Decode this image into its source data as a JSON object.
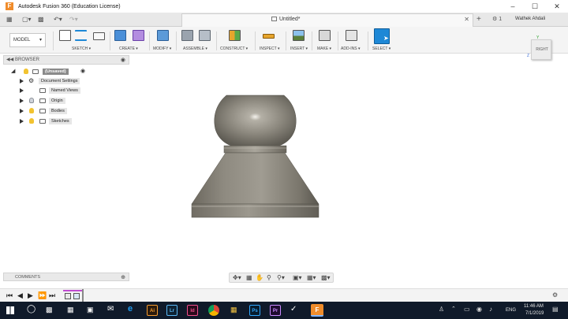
{
  "window": {
    "title": "Autodesk Fusion 360 (Education License)",
    "minimize_icon": "minimize-icon",
    "maximize_icon": "maximize-icon",
    "close_icon": "close-icon"
  },
  "tabbar": {
    "document_tab": "Untitled*",
    "job_count": "1",
    "user": "Wathek Ahdali"
  },
  "toolbar": {
    "workspace": "MODEL",
    "groups": {
      "sketch": "SKETCH",
      "create": "CREATE",
      "modify": "MODIFY",
      "assemble": "ASSEMBLE",
      "construct": "CONSTRUCT",
      "inspect": "INSPECT",
      "insert": "INSERT",
      "make": "MAKE",
      "addins": "ADD-INS",
      "select": "SELECT"
    }
  },
  "viewcube": {
    "face": "RIGHT",
    "axis_y": "Y",
    "axis_z": "Z"
  },
  "browser": {
    "title": "BROWSER",
    "root": "(Unsaved)",
    "items": [
      {
        "label": "Document Settings"
      },
      {
        "label": "Named Views"
      },
      {
        "label": "Origin"
      },
      {
        "label": "Bodies"
      },
      {
        "label": "Sketches"
      }
    ]
  },
  "comments": {
    "title": "COMMENTS"
  },
  "taskbar": {
    "lang": "ENG",
    "time": "11:46 AM",
    "date": "7/1/2019",
    "apps": [
      "Ai",
      "Lr",
      "Id",
      "Ps",
      "Pr",
      "F"
    ]
  },
  "colors": {
    "accent_blue": "#1e88d6",
    "fusion_orange": "#f08c2b",
    "model_gray": "#7e7a70"
  }
}
